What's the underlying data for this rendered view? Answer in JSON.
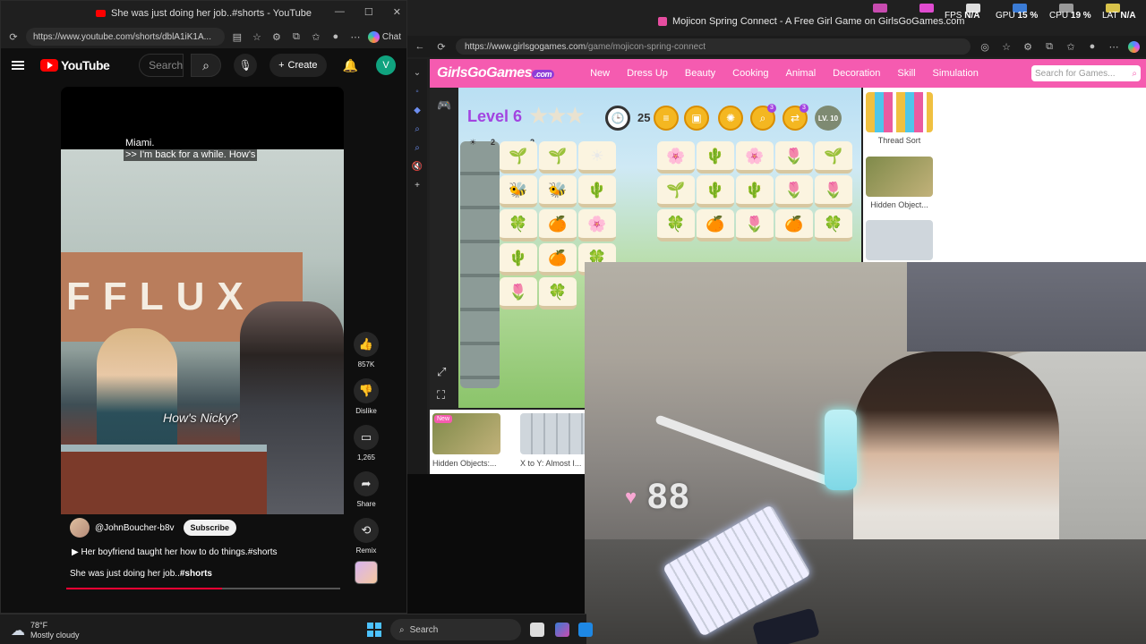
{
  "youtube_window": {
    "tab_title": "She was just doing her job..#shorts - YouTube",
    "url": "https://www.youtube.com/shorts/dblA1iK1A...",
    "chat_label": "Chat",
    "header": {
      "logo_text": "YouTube",
      "search_placeholder": "Search",
      "create_label": "Create",
      "avatar_letter": "V"
    },
    "short": {
      "caption_line1": "Miami.",
      "caption_line2": ">> I'm back for a while. How's",
      "sign_text": "FFLUX",
      "scene_caption": "How's Nicky?",
      "like_count": "857K",
      "dislike_label": "Dislike",
      "comment_count": "1,265",
      "share_label": "Share",
      "remix_label": "Remix",
      "channel": "@JohnBoucher-b8v",
      "subscribe_label": "Subscribe",
      "description": "Her boyfriend taught her how to do things.#shorts",
      "title_prefix": "She was just doing her job..",
      "title_tag": "#shorts",
      "progress": 0.57
    }
  },
  "game_window": {
    "tab_title": "Mojicon Spring Connect - A Free Girl Game on GirlsGoGames.com",
    "url_host": "https://www.girlsgogames.com",
    "url_path": "/game/mojicon-spring-connect",
    "site": {
      "logo_text": "GirlsGoGames",
      "logo_suffix": ".com",
      "nav": [
        "New",
        "Dress Up",
        "Beauty",
        "Cooking",
        "Animal",
        "Decoration",
        "Skill",
        "Simulation"
      ],
      "search_placeholder": "Search for Games..."
    },
    "game": {
      "level_label": "Level 6",
      "timer_partial": "25",
      "lv_badge": "LV. 10",
      "counter_left": "2",
      "counter_right": "2",
      "tool_badges": [
        "3",
        "3"
      ]
    },
    "related_side": [
      {
        "title": "Thread Sort",
        "color": "#e8f4fb"
      },
      {
        "title": "Hidden Object...",
        "color": "#7f8a4a"
      },
      {
        "title": "",
        "color": "#cfd6dc"
      }
    ],
    "related_bottom": [
      {
        "title": "Hidden Objects:...",
        "badge": "New",
        "color": "#7f8a4a"
      },
      {
        "title": "X to Y: Almost I...",
        "color": "#cfd6dc"
      }
    ]
  },
  "overlay": {
    "fps_label": "FPS",
    "fps_value": "N/A",
    "gpu_label": "GPU",
    "gpu_value": "15 %",
    "cpu_label": "CPU",
    "cpu_value": "19 %",
    "lat_label": "LAT",
    "lat_value": "N/A"
  },
  "webcam": {
    "heart_count": "88"
  },
  "taskbar": {
    "temperature": "78°F",
    "weather": "Mostly cloudy",
    "search_placeholder": "Search"
  }
}
